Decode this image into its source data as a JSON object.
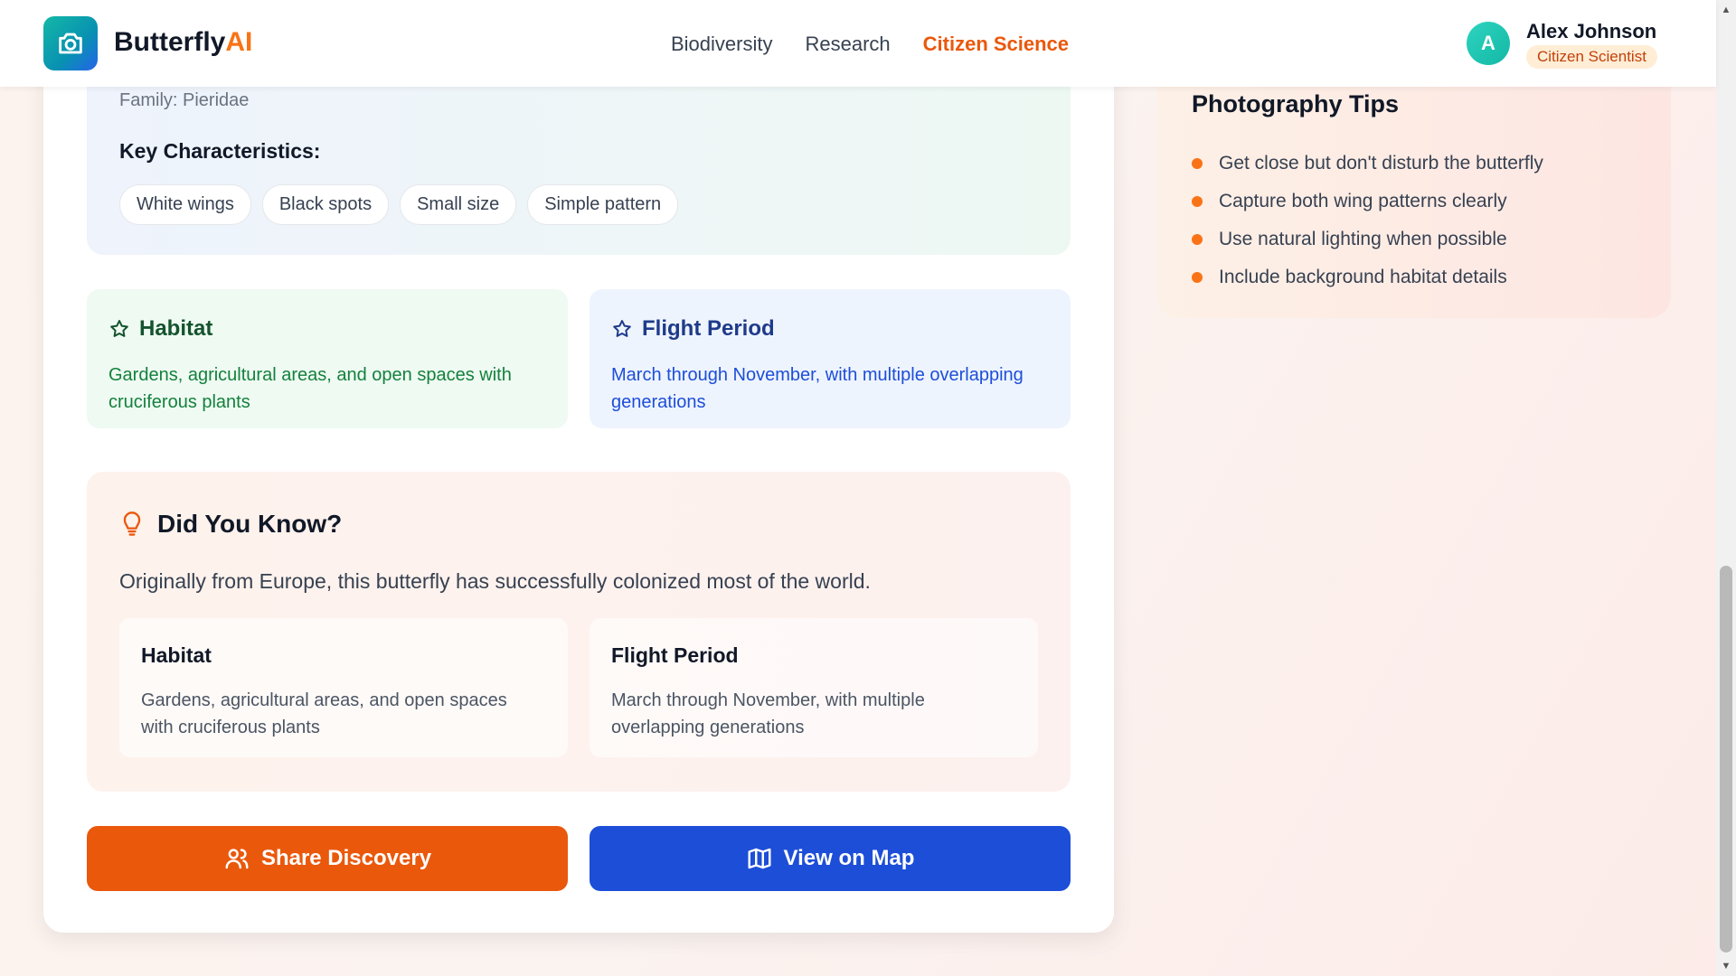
{
  "header": {
    "brand_main": "Butterfly",
    "brand_accent": "AI",
    "nav": [
      "Biodiversity",
      "Research",
      "Citizen Science"
    ],
    "active_nav": "Citizen Science",
    "user": {
      "initial": "A",
      "name": "Alex Johnson",
      "role": "Citizen Scientist"
    }
  },
  "identification": {
    "family": "Family: Pieridae",
    "key_title": "Key Characteristics:",
    "chips": [
      "White wings",
      "Black spots",
      "Small size",
      "Simple pattern"
    ]
  },
  "habitat": {
    "title": "Habitat",
    "text": "Gardens, agricultural areas, and open spaces with cruciferous plants"
  },
  "flight_period": {
    "title": "Flight Period",
    "text": "March through November, with multiple overlapping generations"
  },
  "did_you_know": {
    "title": "Did You Know?",
    "text": "Originally from Europe, this butterfly has successfully colonized most of the world.",
    "habitat_title": "Habitat",
    "habitat_text": "Gardens, agricultural areas, and open spaces with cruciferous plants",
    "flight_title": "Flight Period",
    "flight_text": "March through November, with multiple overlapping generations"
  },
  "actions": {
    "share": "Share Discovery",
    "map": "View on Map"
  },
  "tips": {
    "title": "Photography Tips",
    "items": [
      "Get close but don't disturb the butterfly",
      "Capture both wing patterns clearly",
      "Use natural lighting when possible",
      "Include background habitat details"
    ]
  },
  "colors": {
    "accent_orange": "#ea580c",
    "accent_blue": "#1d4ed8",
    "brand_teal": "#14b8a6"
  },
  "icons": {
    "logo": "camera-icon",
    "habitat": "star-icon",
    "flight": "star-icon",
    "did_you_know": "lightbulb-icon",
    "share": "users-icon",
    "map": "map-icon"
  }
}
